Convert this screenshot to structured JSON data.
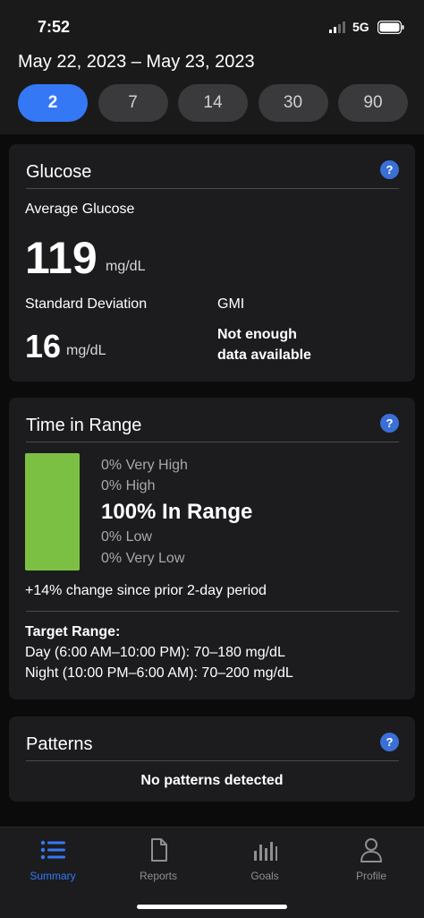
{
  "status": {
    "time": "7:52",
    "network": "5G"
  },
  "header": {
    "date_range": "May 22, 2023 – May 23, 2023",
    "periods": [
      {
        "label": "2",
        "selected": true
      },
      {
        "label": "7",
        "selected": false
      },
      {
        "label": "14",
        "selected": false
      },
      {
        "label": "30",
        "selected": false
      },
      {
        "label": "90",
        "selected": false
      }
    ]
  },
  "glucose": {
    "title": "Glucose",
    "help": "?",
    "avg_label": "Average Glucose",
    "avg_value": "119",
    "avg_unit": "mg/dL",
    "sd_label": "Standard Deviation",
    "sd_value": "16",
    "sd_unit": "mg/dL",
    "gmi_label": "GMI",
    "gmi_line1": "Not enough",
    "gmi_line2": "data available"
  },
  "time_in_range": {
    "title": "Time in Range",
    "help": "?",
    "in_range_fraction": 1.0,
    "very_high": "0% Very High",
    "high": "0% High",
    "in_range": "100% In Range",
    "low": "0% Low",
    "very_low": "0% Very Low",
    "change": "+14% change since prior 2-day period",
    "target_title": "Target Range:",
    "target_day": "Day (6:00 AM–10:00 PM): 70–180 mg/dL",
    "target_night": "Night (10:00 PM–6:00 AM): 70–200 mg/dL",
    "bar_color": "#7cc043"
  },
  "patterns": {
    "title": "Patterns",
    "help": "?",
    "message": "No patterns detected"
  },
  "tabbar": {
    "items": [
      {
        "label": "Summary",
        "icon": "list-icon",
        "active": true
      },
      {
        "label": "Reports",
        "icon": "document-icon",
        "active": false
      },
      {
        "label": "Goals",
        "icon": "bar-chart-icon",
        "active": false
      },
      {
        "label": "Profile",
        "icon": "person-icon",
        "active": false
      }
    ]
  },
  "colors": {
    "accent": "#3478f6",
    "card": "#1c1c1e",
    "in_range": "#7cc043"
  }
}
